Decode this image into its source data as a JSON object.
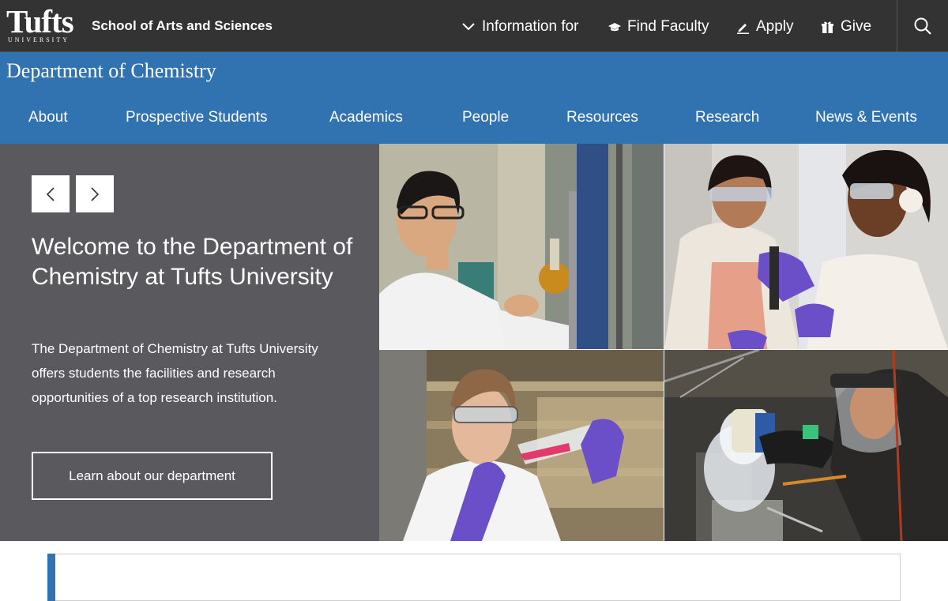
{
  "header": {
    "logo_text": "Tufts",
    "logo_subtext": "UNIVERSITY",
    "school_name": "School of Arts and Sciences",
    "utility_nav": [
      {
        "label": "Information for",
        "icon": "chevron-down-icon"
      },
      {
        "label": "Find Faculty",
        "icon": "graduation-cap-icon"
      },
      {
        "label": "Apply",
        "icon": "pencil-icon"
      },
      {
        "label": "Give",
        "icon": "gift-icon"
      }
    ],
    "search_icon": "search-icon"
  },
  "department": {
    "title": "Department of Chemistry",
    "nav": [
      "About",
      "Prospective Students",
      "Academics",
      "People",
      "Resources",
      "Research",
      "News & Events"
    ]
  },
  "hero": {
    "prev_icon": "chevron-left-icon",
    "next_icon": "chevron-right-icon",
    "title": "Welcome to the Department of Chemistry at Tufts University",
    "body": "The Department of Chemistry at Tufts University offers students the facilities and research opportunities of a top research institution.",
    "cta_label": "Learn about our department"
  },
  "colors": {
    "topbar": "#333333",
    "brand_blue": "#3172b0",
    "hero_panel": "#5a5a5e",
    "glove_purple": "#6b4fc9"
  }
}
